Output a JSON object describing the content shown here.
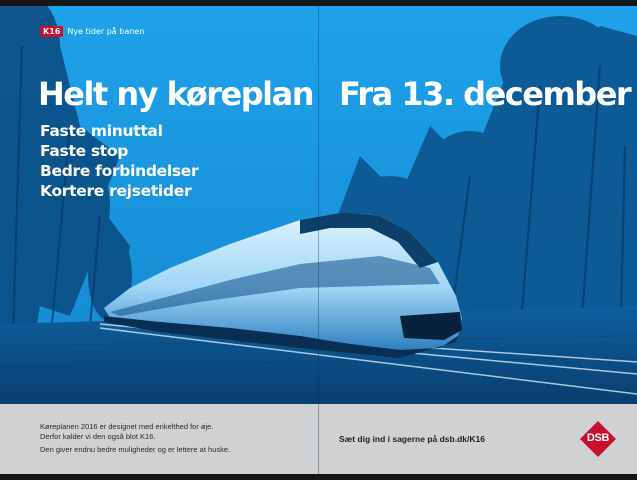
{
  "badge": {
    "code": "K16",
    "tagline": "Nye tider på banen"
  },
  "headline": {
    "left": "Helt ny køreplan",
    "right": "Fra 13. december"
  },
  "bullets": [
    "Faste minuttal",
    "Faste stop",
    "Bedre forbindelser",
    "Kortere rejsetider"
  ],
  "footer": {
    "line1": "Køreplanen 2016 er designet med enkelthed for øje.",
    "line2": "Derfor kalder vi den også blot K16.",
    "line3": "Den giver endnu bedre muligheder og er lettere at huske.",
    "cta": "Sæt dig ind i sagerne på dsb.dk/K16"
  },
  "logo": {
    "text": "DSB"
  },
  "colors": {
    "poster_blue": "#1b98e0",
    "footer_gray": "#cfd1d3",
    "dsb_red": "#c8102e"
  }
}
